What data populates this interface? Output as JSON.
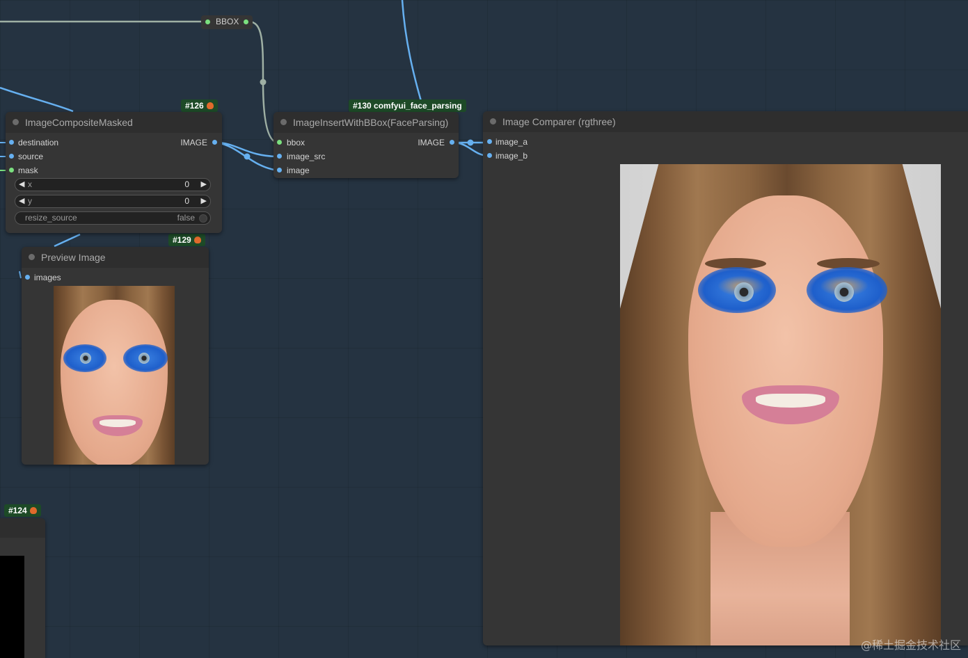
{
  "reroute": {
    "label": "BBOX"
  },
  "badges": {
    "n126": "#126",
    "n130": "#130 comfyui_face_parsing",
    "n129": "#129",
    "n124": "#124"
  },
  "composite_node": {
    "title": "ImageCompositeMasked",
    "inputs": [
      "destination",
      "source",
      "mask"
    ],
    "output": "IMAGE",
    "widgets": {
      "x": {
        "name": "x",
        "value": "0"
      },
      "y": {
        "name": "y",
        "value": "0"
      },
      "resize_source": {
        "name": "resize_source",
        "value": "false"
      }
    }
  },
  "insert_node": {
    "title": "ImageInsertWithBBox(FaceParsing)",
    "inputs": [
      "bbox",
      "image_src",
      "image"
    ],
    "output": "IMAGE"
  },
  "comparer_node": {
    "title": "Image Comparer (rgthree)",
    "inputs": [
      "image_a",
      "image_b"
    ]
  },
  "preview_node": {
    "title": "Preview Image",
    "inputs": [
      "images"
    ]
  },
  "watermark": "@稀土掘金技术社区",
  "colors": {
    "canvas": "#253341",
    "node_body": "#353535",
    "node_title": "#2e2e2e",
    "badge": "#1d4a27",
    "wire_blue": "#66b0f0",
    "wire_grey": "#9fb0a4",
    "eye_shadow": "#1e5fcb"
  }
}
